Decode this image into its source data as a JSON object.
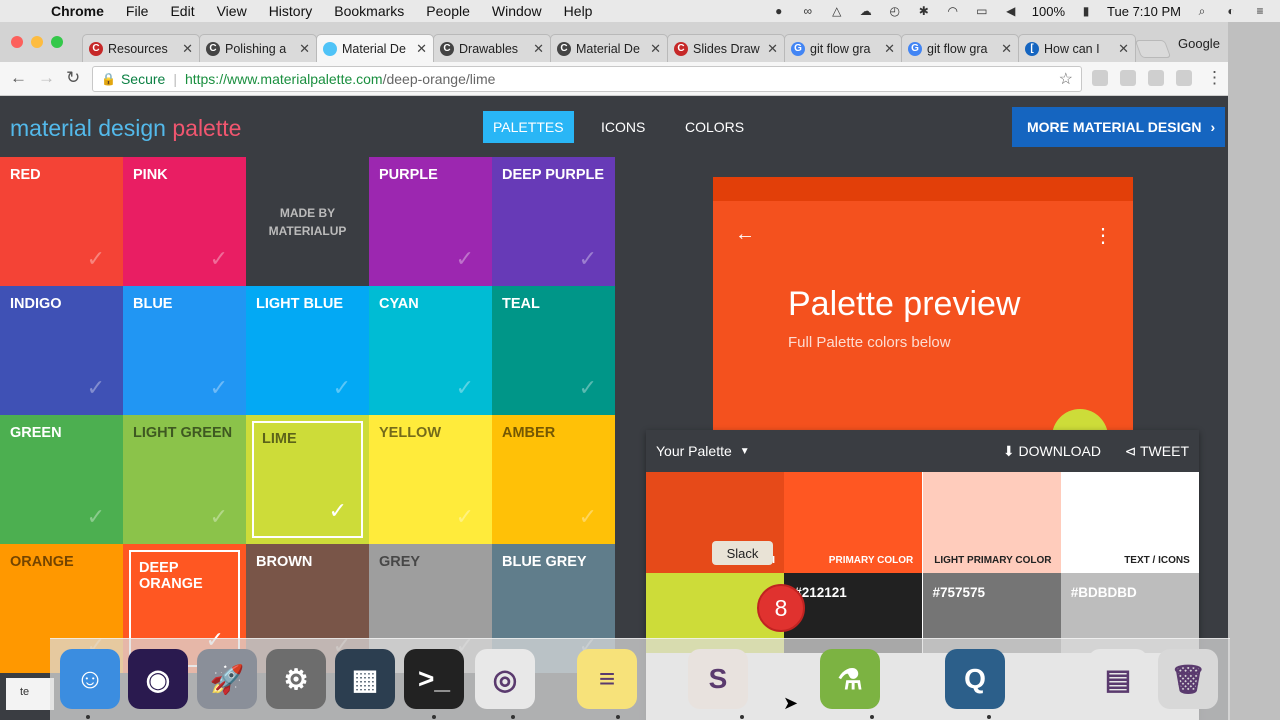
{
  "menubar": {
    "apple": "",
    "app": "Chrome",
    "items": [
      "File",
      "Edit",
      "View",
      "History",
      "Bookmarks",
      "People",
      "Window",
      "Help"
    ],
    "battery": "100%",
    "clock": "Tue 7:10 PM"
  },
  "tabs": [
    {
      "label": "Resources",
      "fav": "C",
      "color": "#c62828"
    },
    {
      "label": "Polishing a",
      "fav": "C",
      "color": "#444444"
    },
    {
      "label": "Material De",
      "fav": "",
      "color": "#4fc3f7"
    },
    {
      "label": "Drawables",
      "fav": "C",
      "color": "#444444"
    },
    {
      "label": "Material De",
      "fav": "C",
      "color": "#444444"
    },
    {
      "label": "Slides Draw",
      "fav": "C",
      "color": "#c62828"
    },
    {
      "label": "git flow gra",
      "fav": "G",
      "color": "#4285f4"
    },
    {
      "label": "git flow gra",
      "fav": "G",
      "color": "#4285f4"
    },
    {
      "label": "How can I",
      "fav": "[",
      "color": "#1565c0"
    }
  ],
  "profile": "Google",
  "address": {
    "secure": "Secure",
    "url_base": "https://www.materialpalette.com",
    "url_path": "/deep-orange/lime"
  },
  "site": {
    "logo_a": "material design",
    "logo_b": "palette",
    "nav": [
      "PALETTES",
      "ICONS",
      "COLORS"
    ],
    "more": "MORE MATERIAL DESIGN"
  },
  "swatches": [
    {
      "label": "RED",
      "color": "#f44336"
    },
    {
      "label": "PINK",
      "color": "#e91e63"
    },
    {
      "label": "MADE BY MATERIALUP",
      "color": "#3a3d42",
      "special": true
    },
    {
      "label": "PURPLE",
      "color": "#9c27b0"
    },
    {
      "label": "DEEP PURPLE",
      "color": "#673ab7"
    },
    {
      "label": "INDIGO",
      "color": "#3f51b5"
    },
    {
      "label": "BLUE",
      "color": "#2196f3"
    },
    {
      "label": "LIGHT BLUE",
      "color": "#03a9f4"
    },
    {
      "label": "CYAN",
      "color": "#00bcd4"
    },
    {
      "label": "TEAL",
      "color": "#009688"
    },
    {
      "label": "GREEN",
      "color": "#4caf50"
    },
    {
      "label": "LIGHT GREEN",
      "color": "#8bc34a",
      "dark": true
    },
    {
      "label": "LIME",
      "color": "#cddc39",
      "dark": true,
      "selected": true
    },
    {
      "label": "YELLOW",
      "color": "#ffeb3b",
      "dark": true
    },
    {
      "label": "AMBER",
      "color": "#ffc107",
      "dark": true
    },
    {
      "label": "ORANGE",
      "color": "#ff9800",
      "dark": true
    },
    {
      "label": "DEEP ORANGE",
      "color": "#ff5722",
      "selected": true
    },
    {
      "label": "BROWN",
      "color": "#795548"
    },
    {
      "label": "GREY",
      "color": "#9e9e9e",
      "dark": true
    },
    {
      "label": "BLUE GREY",
      "color": "#607d8b"
    }
  ],
  "preview": {
    "title": "Palette preview",
    "subtitle": "Full Palette colors below"
  },
  "palette": {
    "title": "Your Palette",
    "download": "DOWNLOAD",
    "tweet": "TWEET",
    "row1": [
      {
        "label": "DARK PRI",
        "color": "#e64a19",
        "fg": "#ffffff"
      },
      {
        "label": "PRIMARY COLOR",
        "color": "#ff5722",
        "fg": "#ffffff"
      },
      {
        "label": "LIGHT PRIMARY COLOR",
        "color": "#ffccbc",
        "fg": "#212121"
      },
      {
        "label": "TEXT / ICONS",
        "color": "#ffffff",
        "fg": "#212121"
      }
    ],
    "row2": [
      {
        "label": "",
        "color": "#cddc39"
      },
      {
        "label": "#212121",
        "color": "#212121"
      },
      {
        "label": "#757575",
        "color": "#757575"
      },
      {
        "label": "#BDBDBD",
        "color": "#bdbdbd"
      }
    ]
  },
  "tooltip": "Slack",
  "slack_badge": "8",
  "dock": [
    {
      "name": "finder",
      "glyph": "☺",
      "color": "#3b8de0"
    },
    {
      "name": "siri",
      "glyph": "◉",
      "color": "#2a1a4f"
    },
    {
      "name": "launchpad",
      "glyph": "🚀",
      "color": "#8a8f99"
    },
    {
      "name": "system-preferences",
      "glyph": "⚙",
      "color": "#6d6d6d"
    },
    {
      "name": "mission-control",
      "glyph": "▦",
      "color": "#2c3e50"
    },
    {
      "name": "terminal",
      "glyph": ">_",
      "color": "#222222"
    },
    {
      "name": "chrome",
      "glyph": "◎",
      "color": "#e8e8e8"
    },
    {
      "name": "notes",
      "glyph": "≡",
      "color": "#f7e27a"
    },
    {
      "name": "slack",
      "glyph": "S",
      "color": "#e8e2de"
    },
    {
      "name": "android-studio",
      "glyph": "⚗",
      "color": "#7cb342"
    },
    {
      "name": "quicktime",
      "glyph": "Q",
      "color": "#2c5f8a"
    },
    {
      "name": "csv-file",
      "glyph": "▤",
      "color": "#e6e6e6"
    },
    {
      "name": "trash",
      "glyph": "🗑",
      "color": "#d8d8d8"
    }
  ]
}
